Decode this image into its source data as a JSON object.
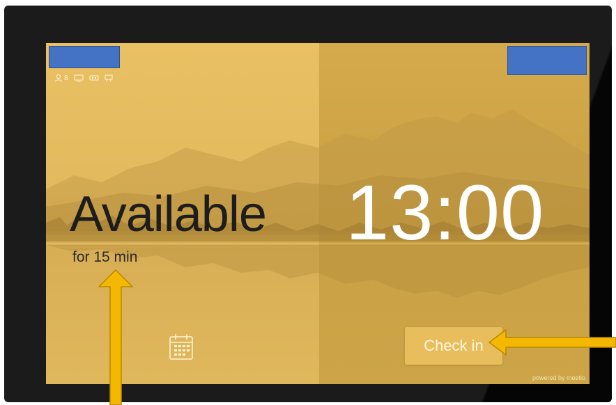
{
  "amenities": [
    {
      "icon": "person-icon",
      "count": "8"
    },
    {
      "icon": "display-icon",
      "count": ""
    },
    {
      "icon": "videoconference-icon",
      "count": ""
    },
    {
      "icon": "projector-icon",
      "count": ""
    }
  ],
  "room": {
    "status": "Available",
    "duration": "for 15 min",
    "clock": "13:00"
  },
  "actions": {
    "check_in_label": "Check in",
    "calendar_icon": "calendar-icon"
  },
  "footer": {
    "powered_by": "powered by meetio"
  },
  "colors": {
    "screen_accent": "#dfb653",
    "button": "#e8be5d",
    "annotation_arrow": "#f5b800",
    "redaction": "#4472c4"
  }
}
